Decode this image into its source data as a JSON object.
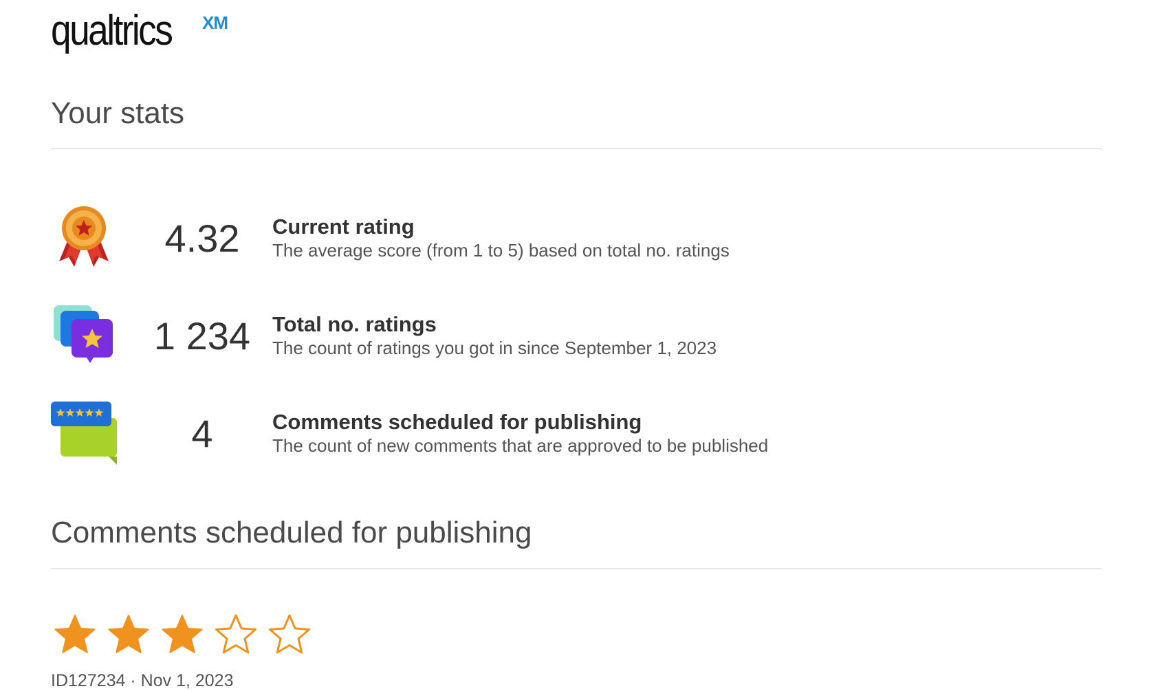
{
  "logo": {
    "word": "qualtrics",
    "suffix": "XM"
  },
  "stats_section": {
    "title": "Your stats"
  },
  "stats": [
    {
      "icon": "medal-icon",
      "value": "4.32",
      "title": "Current rating",
      "description": "The average score (from 1 to 5) based on total no. ratings"
    },
    {
      "icon": "rating-chat-bubbles-icon",
      "value": "1 234",
      "title": "Total no. ratings",
      "description": "The count of ratings you got in since September 1, 2023"
    },
    {
      "icon": "comment-stars-icon",
      "value": "4",
      "title": "Comments scheduled for publishing",
      "description": "The count of new comments that are approved to be published"
    }
  ],
  "comments_section": {
    "title": "Comments scheduled for publishing"
  },
  "comment": {
    "rating": 3,
    "rating_max": 5,
    "id": "ID127234",
    "separator": "·",
    "date": "Nov 1, 2023"
  },
  "colors": {
    "star_filled": "#f0921e",
    "star_outline": "#f0921e",
    "logo_accent": "#1f8dde"
  }
}
